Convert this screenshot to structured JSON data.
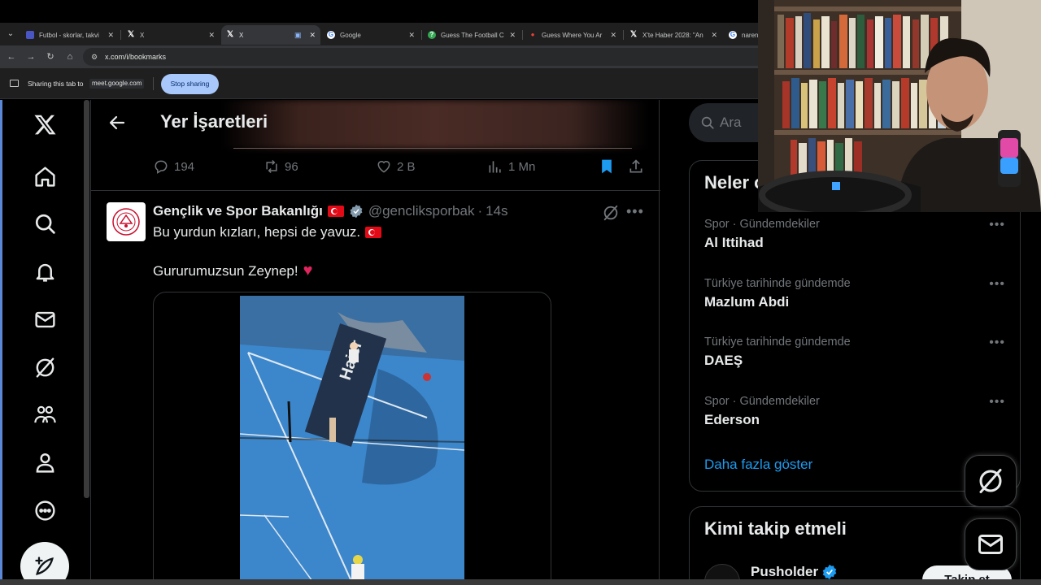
{
  "browser": {
    "tabs": [
      {
        "label": "Futbol - skorlar, takvi",
        "favicon": "flashscore-icon"
      },
      {
        "label": "X",
        "favicon": "x-logo-icon"
      },
      {
        "label": "X",
        "favicon": "x-logo-icon",
        "active": true
      },
      {
        "label": "Google",
        "favicon": "google-icon"
      },
      {
        "label": "Guess The Football C",
        "favicon": "guess-icon"
      },
      {
        "label": "Guess Where You Ar",
        "favicon": "map-pin-icon"
      },
      {
        "label": "X'te Haber 2028: \"An",
        "favicon": "x-logo-icon"
      },
      {
        "label": "narend",
        "favicon": "google-icon"
      }
    ],
    "url": "x.com/i/bookmarks",
    "sharing_text": "Sharing this tab to",
    "sharing_host": "meet.google.com",
    "stop_sharing": "Stop sharing"
  },
  "page": {
    "title": "Yer İşaretleri"
  },
  "prev_post": {
    "replies": "194",
    "reposts": "96",
    "likes": "2 B",
    "views": "1 Mn"
  },
  "post": {
    "author": "Gençlik ve Spor Bakanlığı",
    "handle": "@gencliksporbak",
    "time": "14s",
    "line1": "Bu yurdun kızları, hepsi de yavuz.",
    "line2": "Gururumuzsun Zeynep!",
    "media_text": "Haier"
  },
  "sidebar": {
    "search_placeholder": "Ara",
    "trends_title": "Neler o",
    "trends": [
      {
        "category": "Spor · Gündemdekiler",
        "name": "Al Ittihad"
      },
      {
        "category": "Türkiye tarihinde gündemde",
        "name": "Mazlum Abdi"
      },
      {
        "category": "Türkiye tarihinde gündemde",
        "name": "DAEŞ"
      },
      {
        "category": "Spor · Gündemdekiler",
        "name": "Ederson"
      }
    ],
    "show_more": "Daha fazla göster",
    "follow_title": "Kimi takip etmeli",
    "follow_user": "Pusholder",
    "follow_button": "Takip et"
  },
  "colors": {
    "accent": "#1d9bf0",
    "background": "#000000",
    "text": "#e7e9ea",
    "muted": "#71767b",
    "stop_sharing_bg": "#a8c7fa"
  }
}
